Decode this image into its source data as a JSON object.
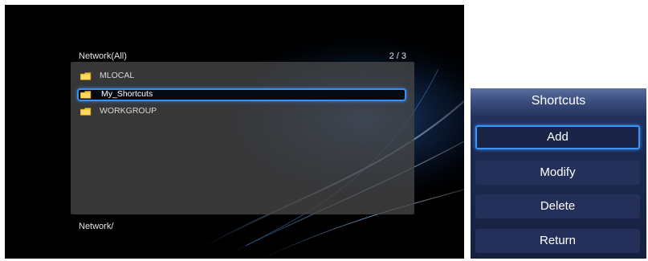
{
  "browser": {
    "title": "Network(All)",
    "page_indicator": "2 / 3",
    "items": [
      {
        "label": "MLOCAL",
        "icon": "folder-icon",
        "selected": false
      },
      {
        "label": "My_Shortcuts",
        "icon": "folder-icon",
        "selected": true
      },
      {
        "label": "WORKGROUP",
        "icon": "folder-icon",
        "selected": false
      }
    ],
    "path": "Network/"
  },
  "shortcuts_menu": {
    "title": "Shortcuts",
    "items": [
      {
        "label": "Add",
        "selected": true
      },
      {
        "label": "Modify",
        "selected": false
      },
      {
        "label": "Delete",
        "selected": false
      },
      {
        "label": "Return",
        "selected": false
      }
    ]
  },
  "colors": {
    "selection": "#3b8ff0",
    "folder": "#f3c43a",
    "popup_bg": "#1d2a52"
  }
}
